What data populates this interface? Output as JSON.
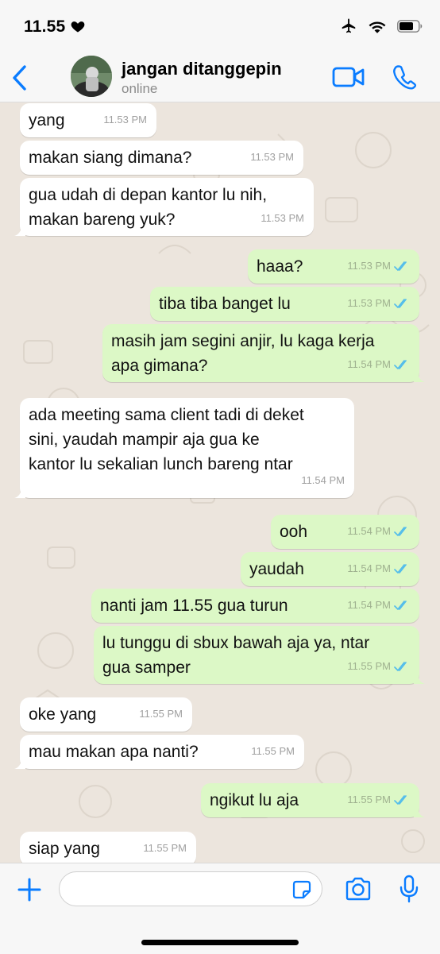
{
  "status_bar": {
    "time": "11.55",
    "heart_icon": "heart-icon",
    "icons": [
      "airplane-icon",
      "wifi-icon",
      "battery-icon"
    ]
  },
  "header": {
    "back_icon": "chevron-left-icon",
    "contact_name": "jangan ditanggepin",
    "contact_status": "online",
    "video_icon": "video-camera-icon",
    "call_icon": "phone-icon"
  },
  "colors": {
    "accent": "#0a7cff",
    "incoming_bubble": "#ffffff",
    "outgoing_bubble": "#dcf8c6",
    "chat_background": "#ece5dd",
    "read_ticks": "#53bdeb"
  },
  "messages": [
    {
      "dir": "in",
      "text": "yang",
      "time": "11.53 PM"
    },
    {
      "dir": "in",
      "text": "makan siang dimana?",
      "time": "11.53 PM"
    },
    {
      "dir": "in",
      "text": "gua udah di depan kantor lu nih,\nmakan bareng yuk?",
      "time": "11.53 PM"
    },
    {
      "dir": "out",
      "text": "haaa?",
      "time": "11.53 PM",
      "status": "read"
    },
    {
      "dir": "out",
      "text": "tiba tiba banget lu",
      "time": "11.53 PM",
      "status": "read"
    },
    {
      "dir": "out",
      "text": "masih jam segini anjir, lu kaga kerja\napa gimana?",
      "time": "11.54 PM",
      "status": "read"
    },
    {
      "dir": "in",
      "text": "ada meeting sama client tadi di deket\nsini, yaudah mampir aja gua ke\nkantor lu sekalian lunch bareng ntar",
      "time": "11.54 PM"
    },
    {
      "dir": "out",
      "text": "ooh",
      "time": "11.54 PM",
      "status": "read"
    },
    {
      "dir": "out",
      "text": "yaudah",
      "time": "11.54 PM",
      "status": "read"
    },
    {
      "dir": "out",
      "text": "nanti jam 11.55 gua turun",
      "time": "11.54 PM",
      "status": "read"
    },
    {
      "dir": "out",
      "text": "lu tunggu di sbux bawah aja ya, ntar\ngua samper",
      "time": "11.55 PM",
      "status": "read"
    },
    {
      "dir": "in",
      "text": "oke yang",
      "time": "11.55 PM"
    },
    {
      "dir": "in",
      "text": "mau makan apa nanti?",
      "time": "11.55 PM"
    },
    {
      "dir": "out",
      "text": "ngikut lu aja",
      "time": "11.55 PM",
      "status": "read"
    },
    {
      "dir": "in",
      "text": "siap yang",
      "time": "11.55 PM"
    }
  ],
  "input_bar": {
    "plus_icon": "plus-icon",
    "input_value": "",
    "sticker_icon": "sticker-icon",
    "camera_icon": "camera-icon",
    "mic_icon": "microphone-icon"
  }
}
